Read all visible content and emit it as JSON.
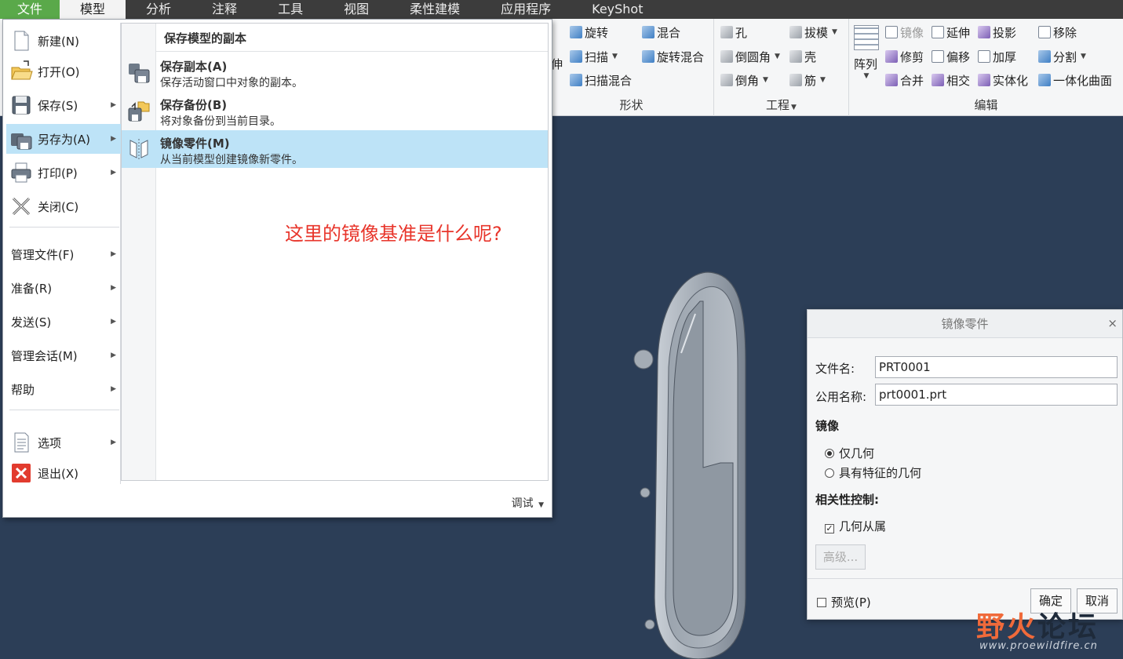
{
  "tabs": [
    "文件",
    "模型",
    "分析",
    "注释",
    "工具",
    "视图",
    "柔性建模",
    "应用程序",
    "KeyShot"
  ],
  "ribbon": {
    "shape": {
      "label": "形状",
      "partial": "伸",
      "items": [
        "旋转",
        "扫描",
        "扫描混合",
        "混合",
        "旋转混合"
      ]
    },
    "engineering": {
      "label": "工程",
      "items": [
        "孔",
        "倒圆角",
        "倒角",
        "拔模",
        "壳",
        "筋"
      ]
    },
    "edit": {
      "label": "编辑",
      "array": "阵列",
      "items": [
        "镜像",
        "延伸",
        "投影",
        "移除",
        "修剪",
        "偏移",
        "加厚",
        "分割",
        "合并",
        "相交",
        "实体化",
        "一体化曲面"
      ]
    }
  },
  "file_menu": {
    "left": {
      "new": "新建(N)",
      "open": "打开(O)",
      "save": "保存(S)",
      "save_as": "另存为(A)",
      "print": "打印(P)",
      "close": "关闭(C)",
      "manage_file": "管理文件(F)",
      "prepare": "准备(R)",
      "send": "发送(S)",
      "manage_session": "管理会话(M)",
      "help": "帮助",
      "options": "选项",
      "exit": "退出(X)"
    },
    "right": {
      "header": "保存模型的副本",
      "items": [
        {
          "title": "保存副本(A)",
          "desc": "保存活动窗口中对象的副本。"
        },
        {
          "title": "保存备份(B)",
          "desc": "将对象备份到当前目录。"
        },
        {
          "title": "镜像零件(M)",
          "desc": "从当前模型创建镜像新零件。"
        }
      ],
      "annotation": "这里的镜像基准是什么呢?"
    },
    "debug": "调试"
  },
  "dialog": {
    "title": "镜像零件",
    "file_name_label": "文件名:",
    "file_name_value": "PRT0001",
    "common_name_label": "公用名称:",
    "common_name_value": "prt0001.prt",
    "mirror_label": "镜像",
    "mirror_options": [
      "仅几何",
      "具有特征的几何"
    ],
    "mirror_selected": 0,
    "dependency_label": "相关性控制:",
    "dependency_option": "几何从属",
    "dependency_checked": true,
    "advanced": "高级...",
    "preview": "预览(P)",
    "ok": "确定",
    "cancel": "取消"
  },
  "watermark": {
    "text_orange": "野火",
    "text_dark": "论坛",
    "url": "www.proewildfire.cn"
  },
  "colors": {
    "file_tab": "#5aa94a",
    "selection": "#bde3f7",
    "viewport": "#2c3e57",
    "annotation": "#e8352b"
  }
}
